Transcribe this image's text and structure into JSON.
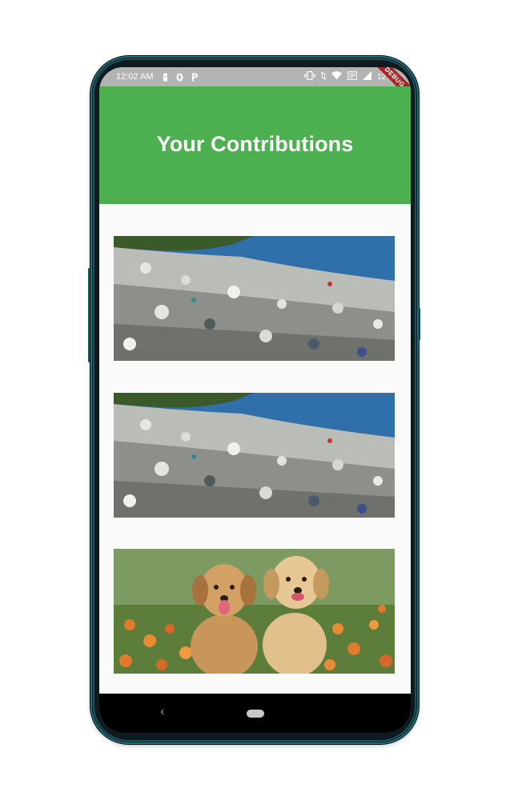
{
  "status_bar": {
    "time": "12:02 AM",
    "battery_text": "12%",
    "icons": [
      "battery-saver-icon",
      "notification-icon",
      "p-icon",
      "vibrate-icon",
      "data-arrows-icon",
      "wifi-icon",
      "volte-icon",
      "signal-icon"
    ]
  },
  "debug_banner": "DEBUG",
  "app_bar": {
    "title": "Your Contributions"
  },
  "contributions": [
    {
      "image": "garbage-dump-image"
    },
    {
      "image": "garbage-dump-image"
    },
    {
      "image": "puppies-image"
    }
  ],
  "nav_bar": {
    "back_glyph": "‹"
  },
  "colors": {
    "app_bar": "#4caf50",
    "status_bar": "#b3b3b3",
    "debug_ribbon": "#a52626",
    "background": "#fafafa",
    "nav_bar": "#000000"
  }
}
